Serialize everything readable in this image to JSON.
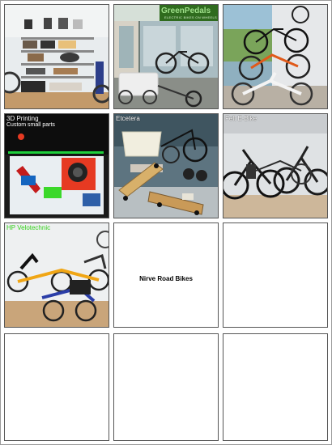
{
  "tiles": [
    {
      "caption": "",
      "subcaption": ""
    },
    {
      "caption": "",
      "subcaption": "",
      "sign": "GreenPedals",
      "sign_sub": "ELECTRIC BIKES ON WHEELS"
    },
    {
      "caption": "",
      "subcaption": ""
    },
    {
      "caption": "3D Printing",
      "subcaption": "Custom small parts"
    },
    {
      "caption": "Etcetera",
      "subcaption": ""
    },
    {
      "caption": "Felt E-Bike",
      "subcaption": ""
    },
    {
      "caption": "HP Velotechnic",
      "subcaption": ""
    },
    {
      "caption": "Nirve Road Bikes",
      "subcaption": ""
    },
    {
      "caption": "",
      "subcaption": ""
    },
    {
      "caption": "",
      "subcaption": ""
    },
    {
      "caption": "",
      "subcaption": ""
    },
    {
      "caption": "",
      "subcaption": ""
    }
  ]
}
